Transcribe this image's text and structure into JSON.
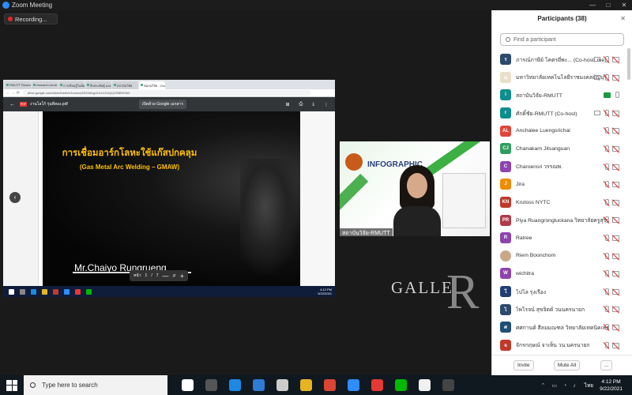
{
  "app": {
    "title": "Zoom Meeting",
    "window_controls": [
      "—",
      "□",
      "✕"
    ]
  },
  "recording": {
    "label": "Recording..."
  },
  "browser": {
    "tabs": [
      "RMUTT Research Sc",
      "research.rmutt.ac",
      "การเรียนรู้ในห้องเรียน",
      "สิ่งประดิษฐ์ และพัฒนา",
      "สถาบันวิจัย",
      "ชมรมวิจัย - Google"
    ],
    "url": "drive.google.com/drive/folders/1vmzczZf2H4Kqp1h1z4-EnQQZSBRhSb0"
  },
  "pdf_viewer": {
    "filename": "งานโลโก้ รุ่นที่สอง.pdf",
    "open_with": "เปิดด้วย Google เอกสาร",
    "page_label": "หน้า",
    "page_current": "1",
    "page_sep": "/",
    "page_total": "7",
    "zoom_minus": "—",
    "zoom_plus": "+"
  },
  "slide": {
    "title_th": "การเชื่อมอาร์กโลหะใช้แก๊สปกคลุม",
    "title_en": "(Gas Metal Arc Welding – GMAW)",
    "author": "Mr.Chaiyo  Rungrueng"
  },
  "shared_taskbar_clock": {
    "time": "4:12 PM",
    "date": "9/22/2021"
  },
  "video": {
    "banner_title": "INFOGRAPHIC",
    "name": "สถาบันวิจัย-RMUTT"
  },
  "gallery_watermark": {
    "text": "GALLE",
    "big_letter": "R"
  },
  "participants": {
    "title": "Participants (38)",
    "close": "✕",
    "search_placeholder": "Find a participant",
    "list": [
      {
        "initials": "ร",
        "color": "#2c4a6b",
        "name": "ภารณ์ภาษีย์ โคตรยี่พะ... (Co-host, me)",
        "icons": [
          "share",
          "mic-muted",
          "cam-off"
        ]
      },
      {
        "initials": "ม",
        "color": "#e8e0c8",
        "name": "มหาวิทยาลัยเทคโนโลยีราชมงคลธัญบุรี (Host)",
        "icons": [
          "share",
          "mic-muted",
          "cam-off"
        ]
      },
      {
        "initials": "i",
        "color": "#0f8e8e",
        "name": "สถาบันวิจัย-RMUTT",
        "icons": [
          "cam-on",
          "mic"
        ]
      },
      {
        "initials": "r",
        "color": "#0f8e8e",
        "name": "ศักดิ์ชัย-RMUTT (Co-host)",
        "icons": [
          "share",
          "mic-muted",
          "cam-off"
        ]
      },
      {
        "initials": "AL",
        "color": "#e0453a",
        "name": "Anchalee Luengsrichai",
        "icons": [
          "mic-muted",
          "cam-off"
        ]
      },
      {
        "initials": "CJ",
        "color": "#2e9e60",
        "name": "Chanakarn Jitsanguan",
        "icons": [
          "mic-muted",
          "cam-off"
        ]
      },
      {
        "initials": "C",
        "color": "#8e44ad",
        "name": "Charoensri วรรณพ.",
        "icons": [
          "mic-muted",
          "cam-off"
        ]
      },
      {
        "initials": "J",
        "color": "#f08c00",
        "name": "Jira",
        "icons": [
          "mic-muted",
          "cam-off"
        ]
      },
      {
        "initials": "KN",
        "color": "#c0392b",
        "name": "Krutoss NYTC",
        "icons": [
          "mic-muted",
          "cam-off"
        ]
      },
      {
        "initials": "PR",
        "color": "#b03a48",
        "name": "Piya Ruangrongluckana วิทยาลัยครูสุรินทร์",
        "icons": [
          "mic-muted",
          "cam-off"
        ]
      },
      {
        "initials": "R",
        "color": "#8e44ad",
        "name": "Ratree",
        "icons": [
          "mic-muted",
          "cam-off"
        ]
      },
      {
        "initials": "",
        "color": "#c9a88a",
        "name": "Riem Boonchom",
        "icons": [
          "mic-muted",
          "cam-off"
        ]
      },
      {
        "initials": "W",
        "color": "#8e44ad",
        "name": "wichitra",
        "icons": [
          "mic-muted",
          "cam-off"
        ]
      },
      {
        "initials": "โ",
        "color": "#1f3f73",
        "name": "โปโล รุ่งเรือง",
        "icons": [
          "mic-muted",
          "cam-off"
        ]
      },
      {
        "initials": "ไ",
        "color": "#2c4a6b",
        "name": "ไพโรจน์ สุขจิตต์ วนนครนายก",
        "icons": [
          "mic-muted",
          "cam-off"
        ]
      },
      {
        "initials": "ศ",
        "color": "#1f4f73",
        "name": "ศศกานต์ สีลมมณฑล วิทยาลัยเทคนิคเพชรบุรี",
        "icons": [
          "mic-muted",
          "cam-off"
        ]
      },
      {
        "initials": "จ",
        "color": "#c0392b",
        "name": "จักรกฤษณ์ จาเห็น วน.นครนายก",
        "icons": [
          "mic-muted",
          "cam-off"
        ]
      }
    ],
    "invite_label": "Invite",
    "mute_all_label": "Mute All",
    "more_label": "..."
  },
  "taskbar": {
    "search_placeholder": "Type here to search",
    "lang": "ไทย",
    "time": "4:12 PM",
    "date": "9/22/2021",
    "app_colors": [
      "#ffffff",
      "#555555",
      "#1e88e5",
      "#2f7bd6",
      "#cccccc",
      "#e6b422",
      "#dd4433",
      "#2d8cff",
      "#e53935",
      "#00b900",
      "#f0f0f0",
      "#444444"
    ]
  }
}
